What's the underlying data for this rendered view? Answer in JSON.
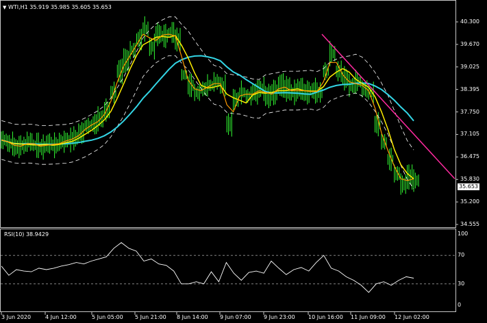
{
  "header": {
    "symbol": "WTI,H1",
    "ohlc": "35.919 35.985 35.605 35.653"
  },
  "rsi": {
    "label": "RSI(10) 38.9429",
    "levels": [
      "100",
      "70",
      "30",
      "0"
    ]
  },
  "current_price": "35.653",
  "price_axis": [
    "40.300",
    "39.670",
    "39.025",
    "38.395",
    "37.750",
    "37.105",
    "36.475",
    "35.830",
    "35.200",
    "34.555"
  ],
  "time_axis": [
    "3 Jun 2020",
    "4 Jun 12:00",
    "5 Jun 05:00",
    "5 Jun 21:00",
    "8 Jun 14:00",
    "9 Jun 07:00",
    "9 Jun 23:00",
    "10 Jun 16:00",
    "11 Jun 09:00",
    "12 Jun 02:00"
  ],
  "colors": {
    "background": "#000000",
    "candles": "#33ff33",
    "ma_fast": "#ff9900",
    "ma_mid": "#ffee00",
    "ma_slow": "#33d6e6",
    "bands": "#ffffff",
    "trendline": "#ff2aa0",
    "rsi_line": "#ffffff"
  },
  "chart_data": [
    {
      "type": "line",
      "series": [
        {
          "values": [
            36.95,
            36.85,
            36.75,
            36.8,
            36.9,
            36.8,
            36.75,
            36.85,
            36.8,
            36.9,
            36.95,
            37.0,
            37.15,
            37.35,
            37.4,
            37.55,
            37.8,
            38.3,
            38.9,
            39.2,
            39.5,
            39.8,
            40.1,
            39.6,
            39.95,
            39.9,
            40.0,
            39.8,
            38.8,
            38.5,
            38.3,
            38.4,
            38.5,
            38.6,
            38.5,
            37.4,
            38.1,
            38.3,
            38.2,
            38.3,
            38.4,
            38.2,
            38.3,
            38.5,
            38.4,
            38.3,
            38.4,
            38.3,
            38.35,
            38.3,
            38.9,
            39.4,
            38.9,
            38.7,
            38.5,
            38.6,
            38.4,
            38.3,
            37.4,
            36.9,
            36.4,
            36.0,
            35.7,
            35.9,
            35.8
          ]
        }
      ],
      "ylim": [
        34.555,
        40.3
      ]
    },
    {
      "type": "line",
      "series": [
        {
          "values": [
            55,
            42,
            50,
            48,
            47,
            52,
            50,
            52,
            55,
            57,
            60,
            58,
            62,
            65,
            68,
            80,
            88,
            80,
            76,
            62,
            65,
            58,
            56,
            48,
            30,
            30,
            33,
            30,
            47,
            33,
            60,
            45,
            35,
            46,
            48,
            45,
            62,
            52,
            43,
            50,
            53,
            48,
            60,
            70,
            52,
            48,
            40,
            35,
            28,
            18,
            30,
            33,
            28,
            35,
            40,
            38
          ]
        }
      ],
      "ylim": [
        0,
        100
      ]
    }
  ]
}
